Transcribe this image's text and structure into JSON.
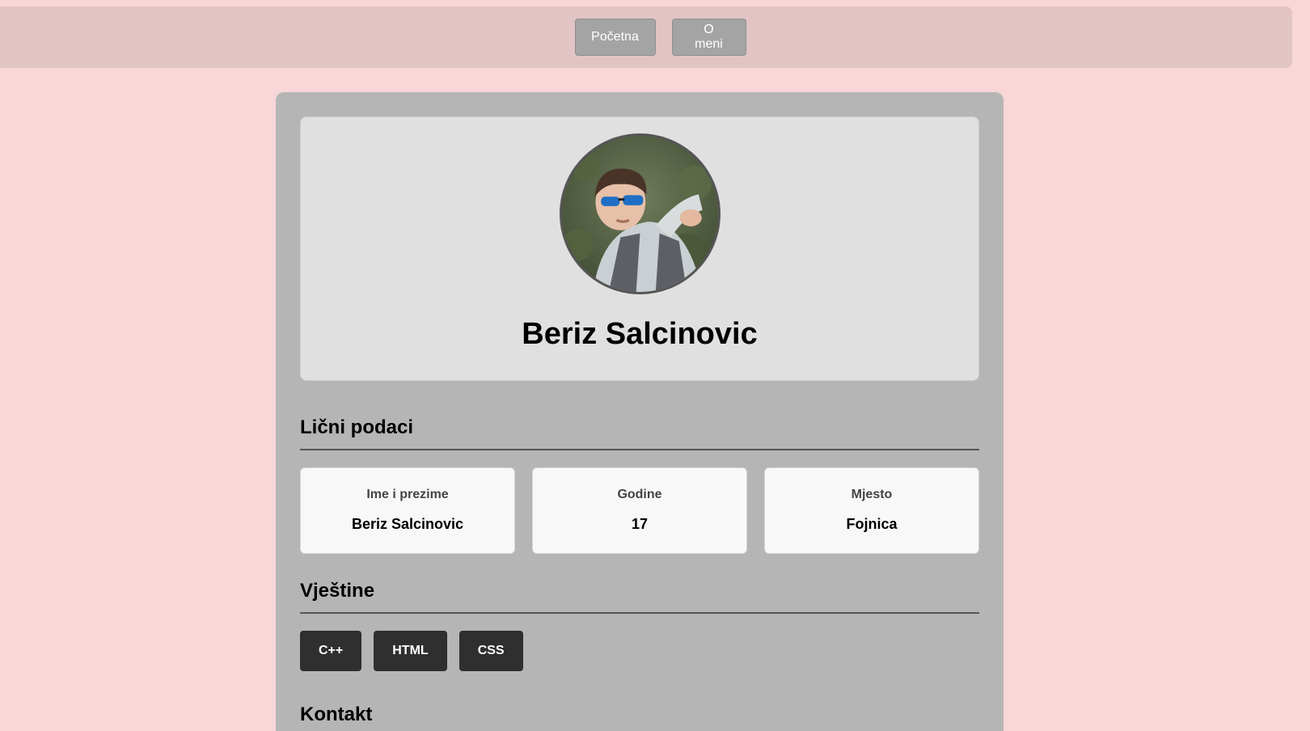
{
  "nav": {
    "home_label": "Početna",
    "about_label": "O meni"
  },
  "profile": {
    "name": "Beriz Salcinovic",
    "avatar_alt": "profile photo"
  },
  "personal": {
    "title": "Lični podaci",
    "cards": [
      {
        "label": "Ime i prezime",
        "value": "Beriz Salcinovic"
      },
      {
        "label": "Godine",
        "value": "17"
      },
      {
        "label": "Mjesto",
        "value": "Fojnica"
      }
    ]
  },
  "skills": {
    "title": "Vještine",
    "items": [
      "C++",
      "HTML",
      "CSS"
    ]
  },
  "contact": {
    "title": "Kontakt"
  },
  "colors": {
    "page_bg": "#f9d6d7",
    "nav_bg": "#e2c4c5",
    "card_bg": "#b5b5b5",
    "chip_bg": "#2f2f2f"
  }
}
